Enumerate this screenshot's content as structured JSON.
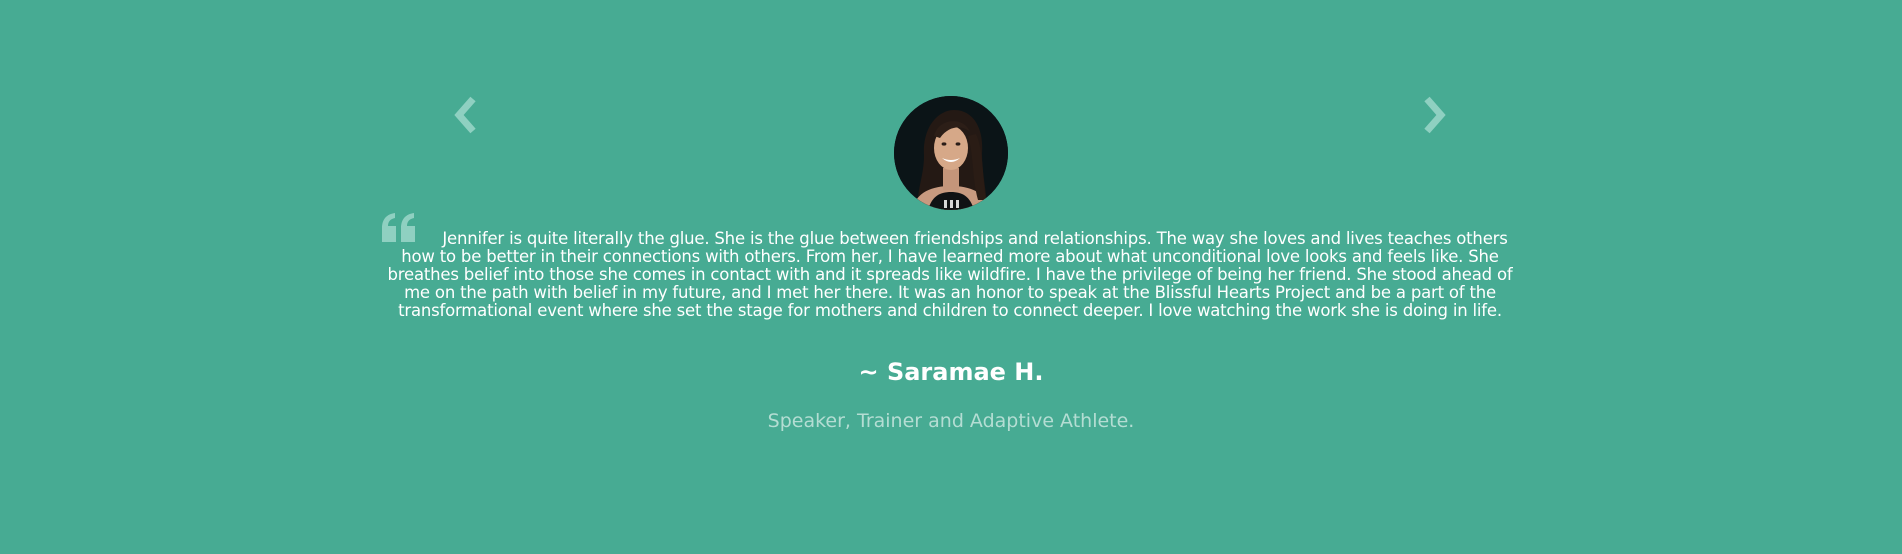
{
  "testimonial": {
    "quote": "Jennifer is quite literally the glue. She is the glue between friendships and relationships. The way she loves and lives teaches others how to be better in their connections with others. From her, I have learned more about what unconditional love looks and feels like. She breathes belief into those she comes in contact with and it spreads like wildfire. I have the privilege of being her friend. She stood ahead of me on the path with belief in my future, and I met her there. It was an honor to speak at the Blissful Hearts Project and be a part of the transformational event where she set the stage for mothers and children to connect deeper. I love watching the work she is doing in life.",
    "author": "~ Saramae H.",
    "role": "Speaker, Trainer and Adaptive Athlete."
  },
  "icons": {
    "prev": "chevron-left-icon",
    "next": "chevron-right-icon",
    "quote": "quote-icon"
  },
  "colors": {
    "background": "#47ab93",
    "text": "#ffffff",
    "muted": "#b4ddd3",
    "icon": "#8fd0c1"
  }
}
